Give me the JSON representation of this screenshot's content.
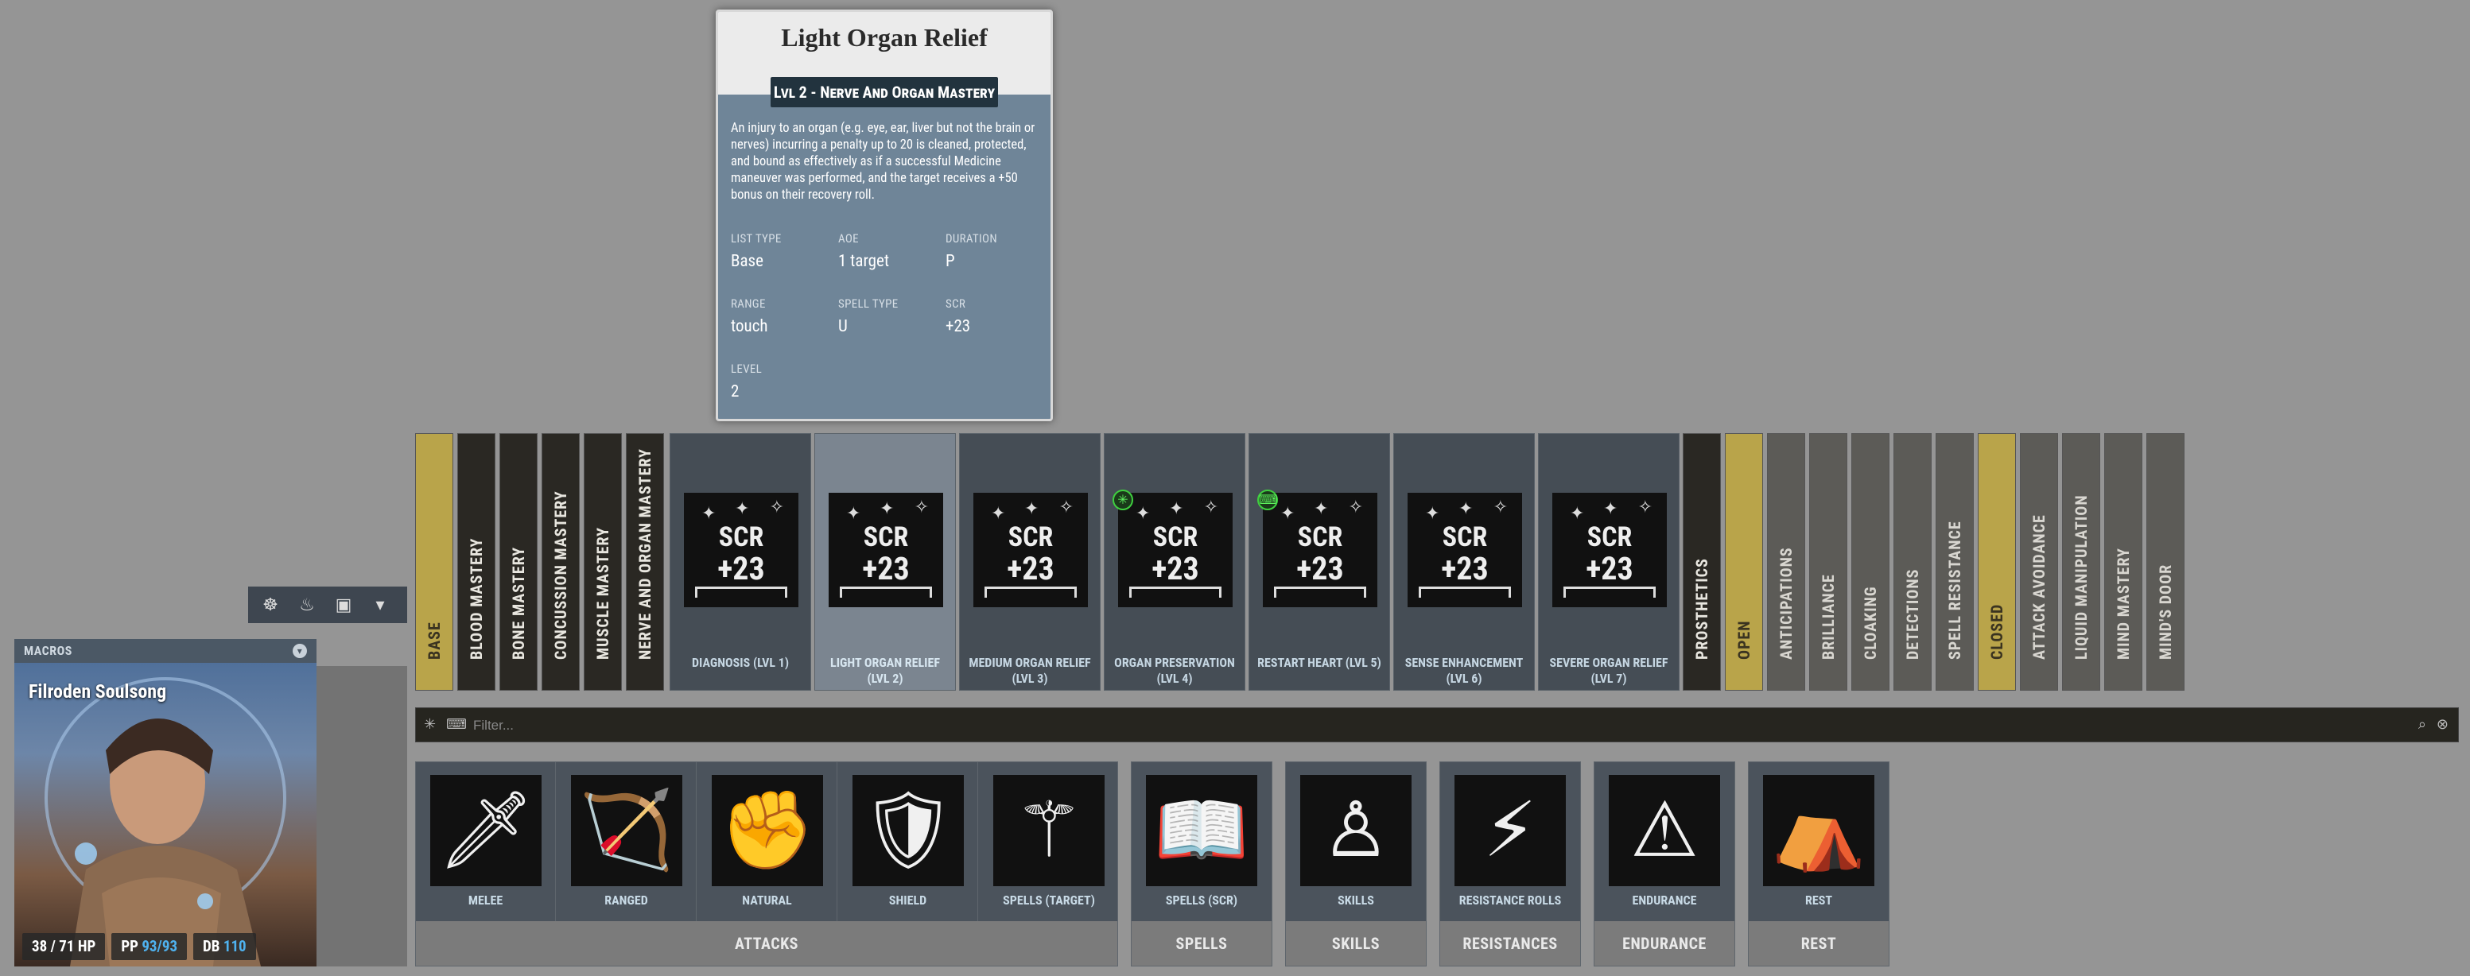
{
  "tooltip": {
    "title": "Light Organ Relief",
    "subtitle": "Lvl 2 - Nerve And Organ Mastery",
    "description": "An injury to an organ (e.g. eye, ear, liver but not the brain or nerves) incurring a penalty up to 20 is cleaned, protected, and bound as effectively as if a successful Medicine maneuver was performed, and the target receives a +50 bonus on their recovery roll.",
    "fields": [
      {
        "key": "LIST TYPE",
        "value": "Base"
      },
      {
        "key": "AOE",
        "value": "1 target"
      },
      {
        "key": "DURATION",
        "value": "P"
      },
      {
        "key": "RANGE",
        "value": "touch"
      },
      {
        "key": "SPELL TYPE",
        "value": "U"
      },
      {
        "key": "SCR",
        "value": "+23"
      },
      {
        "key": "LEVEL",
        "value": "2"
      }
    ]
  },
  "macrobar": {
    "icons": [
      "dice-icon",
      "meditate-icon",
      "backpack-icon",
      "dropdown-icon"
    ]
  },
  "macros": {
    "header": "MACROS",
    "character_name": "Filroden Soulsong",
    "hp": "38 / 71 HP",
    "pp_label": "PP",
    "pp_value": "93/93",
    "db_label": "DB",
    "db_value": "110"
  },
  "left_tabs": [
    {
      "label": "BASE",
      "style": "yellow"
    },
    {
      "label": "BLOOD MASTERY",
      "style": "dark"
    },
    {
      "label": "BONE MASTERY",
      "style": "dark"
    },
    {
      "label": "CONCUSSION MASTERY",
      "style": "dark"
    },
    {
      "label": "MUSCLE MASTERY",
      "style": "dark"
    },
    {
      "label": "NERVE AND ORGAN MASTERY",
      "style": "dark"
    }
  ],
  "spells": [
    {
      "label": "DIAGNOSIS (LVL 1)",
      "scr_top": "SCR",
      "scr_val": "+23"
    },
    {
      "label": "LIGHT ORGAN RELIEF (LVL 2)",
      "scr_top": "SCR",
      "scr_val": "+23",
      "selected": true
    },
    {
      "label": "MEDIUM ORGAN RELIEF (LVL 3)",
      "scr_top": "SCR",
      "scr_val": "+23"
    },
    {
      "label": "ORGAN PRESERVATION (LVL 4)",
      "scr_top": "SCR",
      "scr_val": "+23",
      "badge": "✳"
    },
    {
      "label": "RESTART HEART (LVL 5)",
      "scr_top": "SCR",
      "scr_val": "+23",
      "badge": "⌨"
    },
    {
      "label": "SENSE ENHANCEMENT (LVL 6)",
      "scr_top": "SCR",
      "scr_val": "+23"
    },
    {
      "label": "SEVERE ORGAN RELIEF (LVL 7)",
      "scr_top": "SCR",
      "scr_val": "+23"
    }
  ],
  "right_tabs": [
    {
      "label": "PROSTHETICS",
      "style": "dark"
    },
    {
      "label": "OPEN",
      "style": "yellow"
    },
    {
      "label": "ANTICIPATIONS",
      "style": "gray"
    },
    {
      "label": "BRILLIANCE",
      "style": "gray"
    },
    {
      "label": "CLOAKING",
      "style": "gray"
    },
    {
      "label": "DETECTIONS",
      "style": "gray"
    },
    {
      "label": "SPELL RESISTANCE",
      "style": "gray"
    },
    {
      "label": "CLOSED",
      "style": "yellow"
    },
    {
      "label": "ATTACK AVOIDANCE",
      "style": "gray"
    },
    {
      "label": "LIQUID MANIPULATION",
      "style": "gray"
    },
    {
      "label": "MIND MASTERY",
      "style": "gray"
    },
    {
      "label": "MIND'S DOOR",
      "style": "gray"
    }
  ],
  "filter": {
    "placeholder": "Filter..."
  },
  "groups": [
    {
      "name": "ATTACKS",
      "buttons": [
        {
          "label": "MELEE",
          "icon": "sword-hand-icon",
          "glyph": "🗡"
        },
        {
          "label": "RANGED",
          "icon": "bow-icon",
          "glyph": "🏹"
        },
        {
          "label": "NATURAL",
          "icon": "fist-icon",
          "glyph": "✊"
        },
        {
          "label": "SHIELD",
          "icon": "shield-icon",
          "glyph": "🛡"
        },
        {
          "label": "SPELLS (TARGET)",
          "icon": "wand-icon",
          "glyph": "⚚"
        }
      ]
    },
    {
      "name": "SPELLS",
      "buttons": [
        {
          "label": "SPELLS (SCR)",
          "icon": "spellbook-icon",
          "glyph": "📖"
        }
      ]
    },
    {
      "name": "SKILLS",
      "buttons": [
        {
          "label": "SKILLS",
          "icon": "skill-tree-icon",
          "glyph": "♙"
        }
      ]
    },
    {
      "name": "RESISTANCES",
      "buttons": [
        {
          "label": "RESISTANCE ROLLS",
          "icon": "lightning-icon",
          "glyph": "⚡"
        }
      ]
    },
    {
      "name": "ENDURANCE",
      "buttons": [
        {
          "label": "ENDURANCE",
          "icon": "warning-icon",
          "glyph": "⚠"
        }
      ]
    },
    {
      "name": "REST",
      "buttons": [
        {
          "label": "REST",
          "icon": "tent-icon",
          "glyph": "⛺"
        }
      ]
    }
  ]
}
